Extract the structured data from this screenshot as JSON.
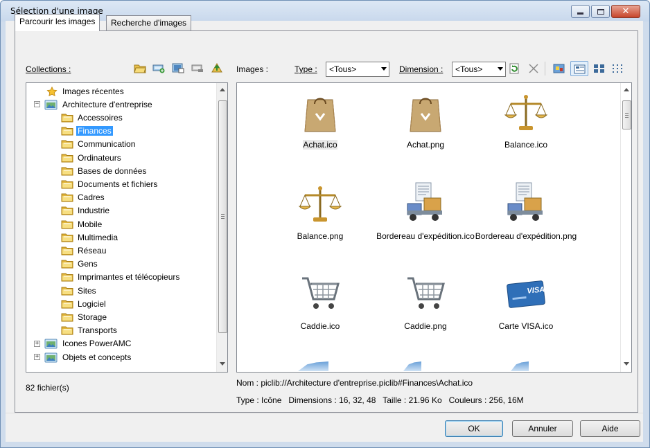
{
  "window": {
    "title": "Sélection d'une image",
    "colors": {
      "accent": "#3399ff",
      "close": "#c7452a"
    }
  },
  "tabs": [
    {
      "label": "Parcourir les images",
      "active": true
    },
    {
      "label": "Recherche d'images",
      "active": false
    }
  ],
  "collections": {
    "label": "Collections :",
    "toolbar_icons": [
      "open-folder-icon",
      "add-collection-icon",
      "edit-collection-icon",
      "remove-collection-icon",
      "export-icon"
    ],
    "tree": [
      {
        "label": "Images récentes",
        "level": 0,
        "icon": "star-icon"
      },
      {
        "label": "Architecture d'entreprise",
        "level": 0,
        "icon": "collection-icon",
        "expander": "−"
      },
      {
        "label": "Accessoires",
        "level": 1,
        "icon": "folder-icon"
      },
      {
        "label": "Finances",
        "level": 1,
        "icon": "folder-icon",
        "selected": true
      },
      {
        "label": "Communication",
        "level": 1,
        "icon": "folder-icon"
      },
      {
        "label": "Ordinateurs",
        "level": 1,
        "icon": "folder-icon"
      },
      {
        "label": "Bases de données",
        "level": 1,
        "icon": "folder-icon"
      },
      {
        "label": "Documents et fichiers",
        "level": 1,
        "icon": "folder-icon"
      },
      {
        "label": "Cadres",
        "level": 1,
        "icon": "folder-icon"
      },
      {
        "label": "Industrie",
        "level": 1,
        "icon": "folder-icon"
      },
      {
        "label": "Mobile",
        "level": 1,
        "icon": "folder-icon"
      },
      {
        "label": "Multimedia",
        "level": 1,
        "icon": "folder-icon"
      },
      {
        "label": "Réseau",
        "level": 1,
        "icon": "folder-icon"
      },
      {
        "label": "Gens",
        "level": 1,
        "icon": "folder-icon"
      },
      {
        "label": "Imprimantes et télécopieurs",
        "level": 1,
        "icon": "folder-icon"
      },
      {
        "label": "Sites",
        "level": 1,
        "icon": "folder-icon"
      },
      {
        "label": "Logiciel",
        "level": 1,
        "icon": "folder-icon"
      },
      {
        "label": "Storage",
        "level": 1,
        "icon": "folder-icon"
      },
      {
        "label": "Transports",
        "level": 1,
        "icon": "folder-icon"
      },
      {
        "label": "Icones PowerAMC",
        "level": 0,
        "icon": "collection-icon",
        "expander": "+"
      },
      {
        "label": "Objets et concepts",
        "level": 0,
        "icon": "collection-icon",
        "expander": "+"
      }
    ],
    "file_count": "82 fichier(s)"
  },
  "images": {
    "label": "Images :",
    "type_label": "Type :",
    "type_value": "<Tous>",
    "dimension_label": "Dimension :",
    "dimension_value": "<Tous>",
    "toolbar_icons": [
      "refresh-icon",
      "delete-icon",
      "large-icons-view-icon",
      "details-view-icon",
      "small-icons-view-icon",
      "list-view-icon"
    ],
    "items": [
      {
        "caption": "Achat.ico",
        "icon": "shopping-bag-icon",
        "selected": true
      },
      {
        "caption": "Achat.png",
        "icon": "shopping-bag-icon"
      },
      {
        "caption": "Balance.ico",
        "icon": "scales-icon"
      },
      {
        "caption": "Balance.png",
        "icon": "scales-icon"
      },
      {
        "caption": "Bordereau d'expédition.ico",
        "icon": "shipping-truck-icon"
      },
      {
        "caption": "Bordereau d'expédition.png",
        "icon": "shipping-truck-icon"
      },
      {
        "caption": "Caddie.ico",
        "icon": "shopping-cart-icon"
      },
      {
        "caption": "Caddie.png",
        "icon": "shopping-cart-icon"
      },
      {
        "caption": "Carte VISA.ico",
        "icon": "credit-card-icon"
      }
    ],
    "card_brand": "VISA"
  },
  "details": {
    "name_line": "Nom : piclib://Architecture d'entreprise.piclib#Finances\\Achat.ico",
    "type_line": "Type : Icône   Dimensions : 16, 32, 48   Taille : 21.96 Ko   Couleurs : 256, 16M"
  },
  "buttons": {
    "ok": "OK",
    "cancel": "Annuler",
    "help": "Aide"
  }
}
